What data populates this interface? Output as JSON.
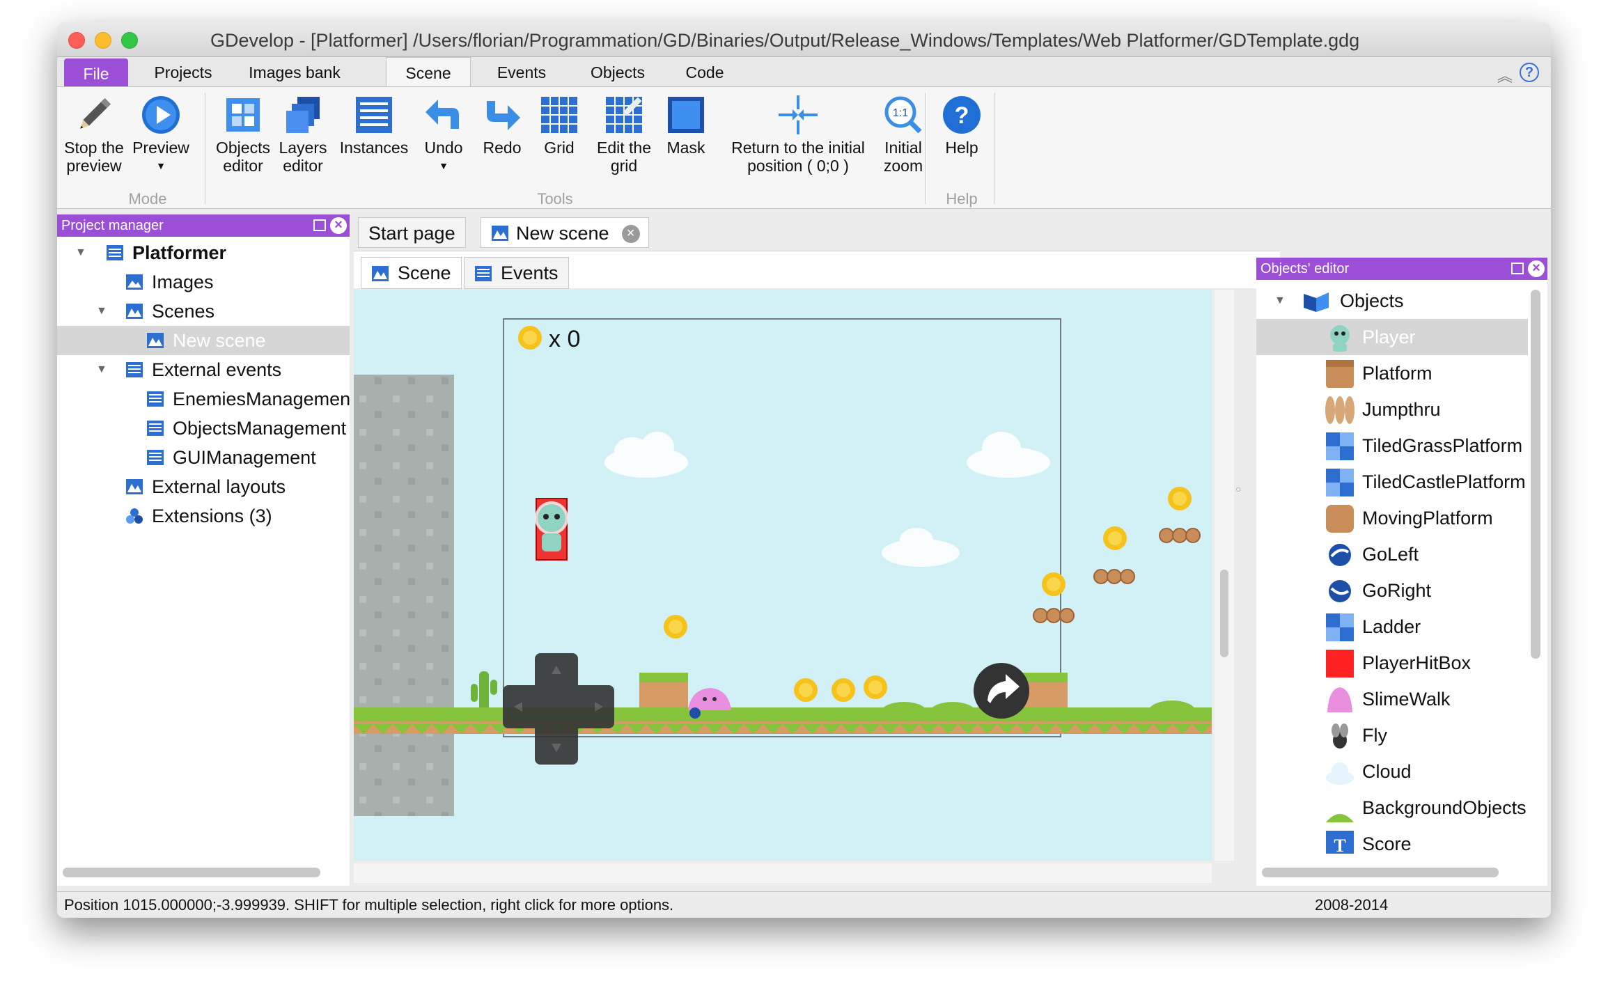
{
  "window": {
    "title": "GDevelop - [Platformer] /Users/florian/Programmation/GD/Binaries/Output/Release_Windows/Templates/Web Platformer/GDTemplate.gdg"
  },
  "ribbon_tabs": [
    "File",
    "Projects",
    "Images bank",
    "Scene",
    "Events",
    "Objects",
    "Code"
  ],
  "active_tab": "Scene",
  "ribbon": {
    "stop_preview": "Stop the preview",
    "preview": "Preview",
    "objects_editor": "Objects editor",
    "layers_editor": "Layers editor",
    "instances": "Instances",
    "undo": "Undo",
    "redo": "Redo",
    "grid": "Grid",
    "edit_grid": "Edit the grid",
    "mask": "Mask",
    "return_initial": "Return to the initial position ( 0;0 )",
    "initial_zoom": "Initial zoom",
    "help": "Help",
    "group_mode": "Mode",
    "group_tools": "Tools",
    "group_help": "Help"
  },
  "project_manager": {
    "title": "Project manager",
    "items": [
      {
        "label": "Platformer",
        "icon": "project-icon"
      },
      {
        "label": "Images",
        "icon": "images-icon"
      },
      {
        "label": "Scenes",
        "icon": "scenes-icon"
      },
      {
        "label": "New scene",
        "icon": "scene-icon"
      },
      {
        "label": "External events",
        "icon": "events-icon"
      },
      {
        "label": "EnemiesManagement",
        "icon": "events-icon"
      },
      {
        "label": "ObjectsManagement",
        "icon": "events-icon"
      },
      {
        "label": "GUIManagement",
        "icon": "events-icon"
      },
      {
        "label": "External layouts",
        "icon": "layout-icon"
      },
      {
        "label": "Extensions (3)",
        "icon": "extensions-icon"
      }
    ]
  },
  "doc_tabs": [
    "Start page",
    "New scene"
  ],
  "scene_tabs": [
    "Scene",
    "Events"
  ],
  "scene": {
    "coin_counter": "x 0"
  },
  "objects_editor": {
    "title": "Objects' editor",
    "root": "Objects",
    "items": [
      "Player",
      "Platform",
      "Jumpthru",
      "TiledGrassPlatform",
      "TiledCastlePlatform",
      "MovingPlatform",
      "GoLeft",
      "GoRight",
      "Ladder",
      "PlayerHitBox",
      "SlimeWalk",
      "Fly",
      "Cloud",
      "BackgroundObjects",
      "Score"
    ]
  },
  "status": {
    "text": "Position 1015.000000;-3.999939. SHIFT for multiple selection, right click for more options.",
    "years": "2008-2014"
  },
  "colors": {
    "accent": "#9b4fd6",
    "sky": "#d2f1f7",
    "grass": "#86c43e"
  }
}
